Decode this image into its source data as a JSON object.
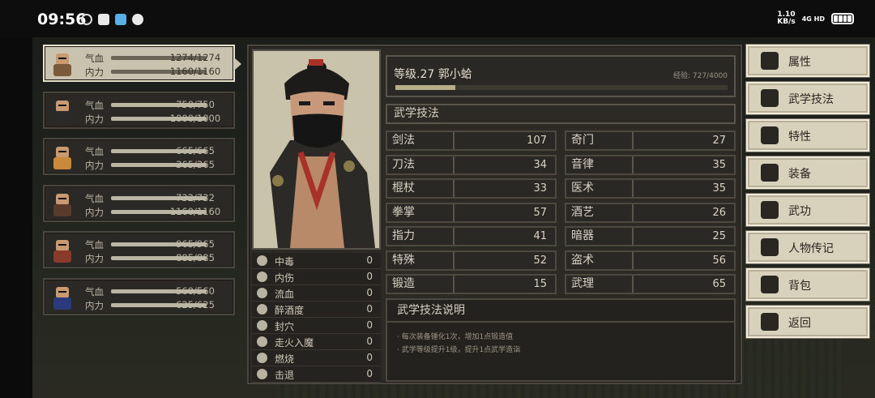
{
  "status_bar": {
    "time": "09:56",
    "net_speed": "1.10",
    "net_unit": "KB/s",
    "signal": "4G HD"
  },
  "party": [
    {
      "hp_label": "气血",
      "mp_label": "内力",
      "hp": "1274/1274",
      "mp": "1160/1160",
      "hp_fill": 1.0,
      "mp_fill": 1.0,
      "color": "#7a5a3a",
      "selected": true
    },
    {
      "hp_label": "气血",
      "mp_label": "内力",
      "hp": "750/750",
      "mp": "1000/1000",
      "hp_fill": 1.0,
      "mp_fill": 1.0,
      "color": "#2a2a2a",
      "selected": false
    },
    {
      "hp_label": "气血",
      "mp_label": "内力",
      "hp": "665/665",
      "mp": "365/365",
      "hp_fill": 1.0,
      "mp_fill": 1.0,
      "color": "#c98a3a",
      "selected": false
    },
    {
      "hp_label": "气血",
      "mp_label": "内力",
      "hp": "732/732",
      "mp": "1160/1160",
      "hp_fill": 1.0,
      "mp_fill": 1.0,
      "color": "#5a3a2a",
      "selected": false
    },
    {
      "hp_label": "气血",
      "mp_label": "内力",
      "hp": "965/965",
      "mp": "885/885",
      "hp_fill": 1.0,
      "mp_fill": 1.0,
      "color": "#8a3a2a",
      "selected": false
    },
    {
      "hp_label": "气血",
      "mp_label": "内力",
      "hp": "560/560",
      "mp": "625/625",
      "hp_fill": 1.0,
      "mp_fill": 1.0,
      "color": "#2a3a7a",
      "selected": false
    }
  ],
  "character": {
    "level_name": "等级.27 郭小蛤",
    "exp": "经验: 727/4000",
    "exp_fill": 0.18
  },
  "status_effects": [
    {
      "name": "中毒",
      "value": "0"
    },
    {
      "name": "内伤",
      "value": "0"
    },
    {
      "name": "流血",
      "value": "0"
    },
    {
      "name": "醉酒度",
      "value": "0"
    },
    {
      "name": "封穴",
      "value": "0"
    },
    {
      "name": "走火入魔",
      "value": "0"
    },
    {
      "name": "燃烧",
      "value": "0"
    },
    {
      "name": "击退",
      "value": "0"
    }
  ],
  "skills_title": "武学技法",
  "skills": [
    {
      "name": "剑法",
      "value": "107"
    },
    {
      "name": "奇门",
      "value": "27"
    },
    {
      "name": "刀法",
      "value": "34"
    },
    {
      "name": "音律",
      "value": "35"
    },
    {
      "name": "棍杖",
      "value": "33"
    },
    {
      "name": "医术",
      "value": "35"
    },
    {
      "name": "拳掌",
      "value": "57"
    },
    {
      "name": "酒艺",
      "value": "26"
    },
    {
      "name": "指力",
      "value": "41"
    },
    {
      "name": "暗器",
      "value": "25"
    },
    {
      "name": "特殊",
      "value": "52"
    },
    {
      "name": "盗术",
      "value": "56"
    },
    {
      "name": "锻造",
      "value": "15"
    },
    {
      "name": "武理",
      "value": "65"
    }
  ],
  "description": {
    "title": "武学技法说明",
    "lines": [
      "· 每次装备锤化1次，增加1点锻造值",
      "· 武学等级提升1级，提升1点武学造诣"
    ]
  },
  "menu": [
    {
      "label": "属性",
      "icon": "person-icon"
    },
    {
      "label": "武学技法",
      "icon": "skills-person-icon"
    },
    {
      "label": "特性",
      "icon": "trait-icon"
    },
    {
      "label": "装备",
      "icon": "sword-icon"
    },
    {
      "label": "武功",
      "icon": "book-icon"
    },
    {
      "label": "人物传记",
      "icon": "scroll-icon"
    },
    {
      "label": "背包",
      "icon": "bag-icon"
    },
    {
      "label": "返回",
      "icon": "door-icon"
    }
  ]
}
